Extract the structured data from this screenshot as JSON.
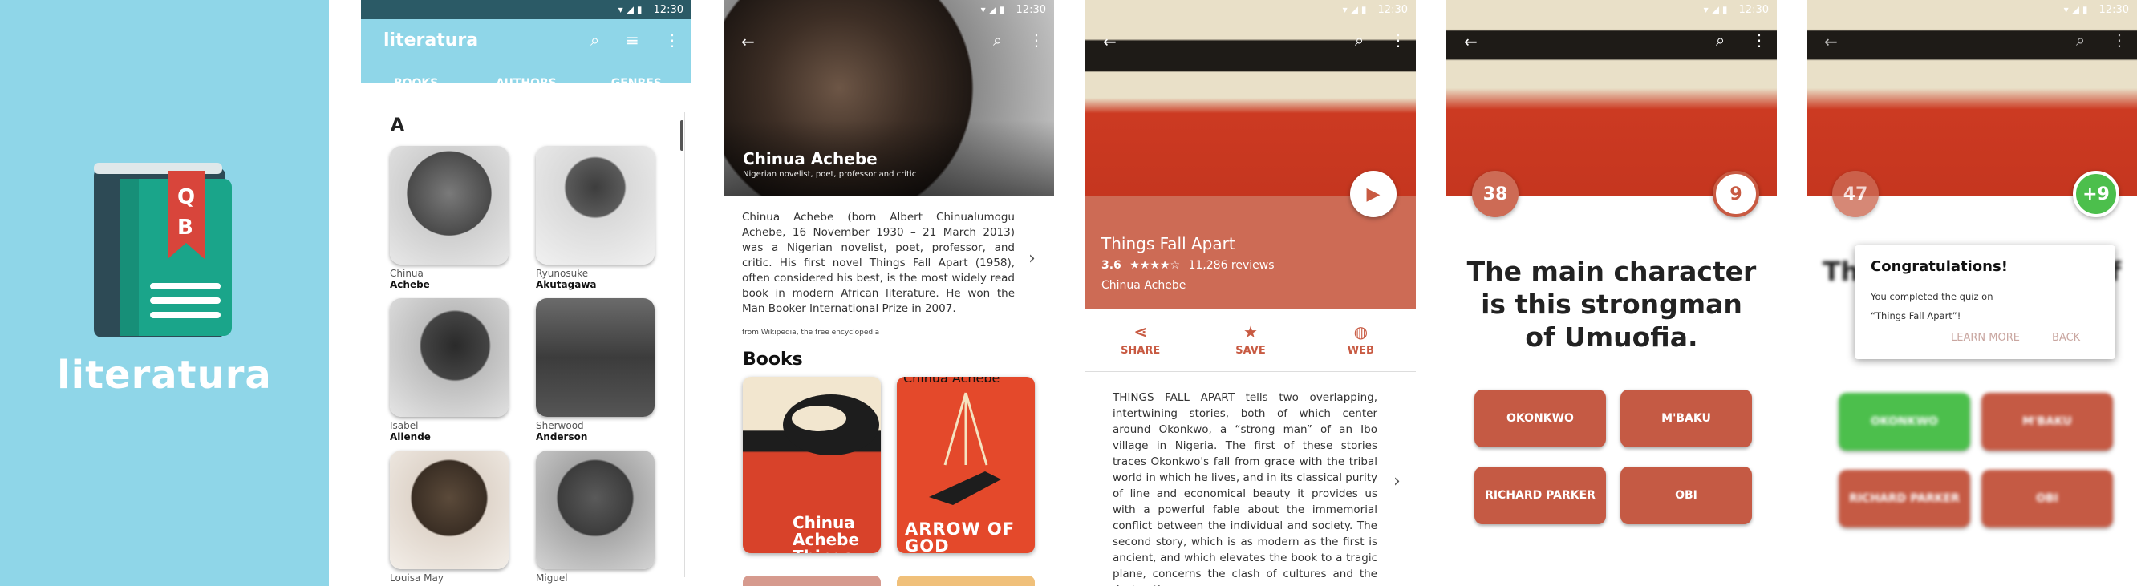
{
  "brand": {
    "app_name": "literatura",
    "logo_letters": [
      "Q",
      "B"
    ]
  },
  "status": {
    "time": "12:30"
  },
  "screen1": {
    "title": "literatura",
    "tabs": [
      {
        "label": "BOOKS"
      },
      {
        "label": "AUTHORS"
      },
      {
        "label": "GENRES"
      }
    ],
    "section_letter": "A",
    "authors": [
      {
        "first": "Chinua",
        "last": "Achebe"
      },
      {
        "first": "Ryunosuke",
        "last": "Akutagawa"
      },
      {
        "first": "Isabel",
        "last": "Allende"
      },
      {
        "first": "Sherwood",
        "last": "Anderson"
      },
      {
        "first": "Louisa May",
        "last": ""
      },
      {
        "first": "Miguel",
        "last": ""
      }
    ]
  },
  "screen2": {
    "author_name": "Chinua Achebe",
    "author_subtitle": "Nigerian novelist, poet, professor and critic",
    "bio": "Chinua Achebe (born Albert Chinualumogu Achebe, 16 November 1930 – 21 March 2013) was a Nigerian novelist, poet, professor, and critic. His first novel Things Fall Apart (1958), often considered his best, is the most widely read book in modern African literature. He won the Man Booker International Prize in 2007.",
    "source": "from Wikipedia, the free encyclopedia",
    "books_heading": "Books",
    "books": [
      {
        "cover_text": "Chinua Achebe Things Fall Apart"
      },
      {
        "cover_text": "ARROW OF GOD",
        "top_text": "Chinua Achebe"
      }
    ]
  },
  "screen3": {
    "book_title": "Things Fall Apart",
    "rating": "3.6",
    "stars": "★★★★☆",
    "reviews": "11,286 reviews",
    "author": "Chinua Achebe",
    "actions": [
      {
        "label": "SHARE"
      },
      {
        "label": "SAVE"
      },
      {
        "label": "WEB"
      }
    ],
    "description": "THINGS FALL APART tells two overlapping, intertwining stories, both of which center around Okonkwo, a “strong man” of an Ibo village in Nigeria. The first of these stories traces Okonkwo's fall from grace with the tribal world in which he lives, and in its classical purity of line and economical beauty it provides us with a powerful fable about the immemorial conflict between the individual and society. The second story, which is as modern as the first is ancient, and which elevates the book to a tragic plane, concerns the clash of cultures and the destruction"
  },
  "screen4": {
    "score": "38",
    "timer": "9",
    "question": "The main character is this strongman of Umuofia.",
    "answers": [
      {
        "label": "OKONKWO"
      },
      {
        "label": "M'BAKU"
      },
      {
        "label": "RICHARD PARKER"
      },
      {
        "label": "OBI"
      }
    ]
  },
  "screen5": {
    "score": "47",
    "bonus": "+9",
    "question_partial": "Th",
    "question_tail": "f",
    "answers": [
      {
        "label": "OKONKWO"
      },
      {
        "label": "M'BAKU"
      },
      {
        "label": "RICHARD PARKER"
      },
      {
        "label": "OBI"
      }
    ],
    "dialog": {
      "title": "Congratulations!",
      "message_line1": "You completed the quiz on",
      "message_line2": "“Things Fall Apart”!",
      "learn_more": "LEARN MORE",
      "back": "BACK"
    }
  },
  "colors": {
    "sky": "#8fd6e8",
    "accent": "#c85a42",
    "green": "#4cbf4c"
  }
}
